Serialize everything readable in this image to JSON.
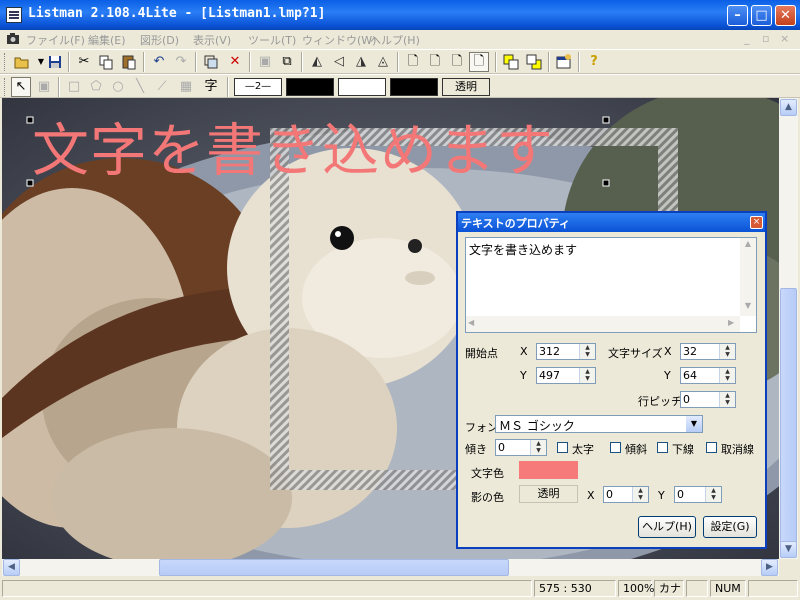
{
  "window": {
    "title": "Listman 2.108.4Lite - [Listman1.lmp?1]",
    "min_glyph": "–",
    "max_glyph": "□",
    "close_glyph": "✕"
  },
  "menu": {
    "items": [
      "ファイル(F)",
      "編集(E)",
      "図形(D)",
      "表示(V)",
      "ツール(T)",
      "ウィンドウ(W)",
      "ヘルプ(H)"
    ],
    "mdi_min": "_",
    "mdi_restore": "▫",
    "mdi_close": "×"
  },
  "toolbar2": {
    "text_tool_glyph": "字",
    "line_style": "—2—",
    "transparent_label": "透明"
  },
  "canvas": {
    "overlay_text": "文字を書き込めます",
    "overlay_color": "#f47777"
  },
  "dialog": {
    "title": "テキストのプロパティ",
    "close_glyph": "×",
    "text_value": "文字を書き込めます",
    "start_label": "開始点",
    "x_label": "X",
    "y_label": "Y",
    "start_x": "312",
    "start_y": "497",
    "size_label": "文字サイズ",
    "size_x": "32",
    "size_y": "64",
    "pitch_label": "行ピッチ",
    "pitch": "0",
    "font_label": "フォント",
    "font_value": "ＭＳ ゴシック",
    "tilt_label": "傾き",
    "tilt": "0",
    "bold_label": "太字",
    "italic_label": "傾斜",
    "underline_label": "下線",
    "strike_label": "取消線",
    "color_label": "文字色",
    "text_color": "#f77a7a",
    "shadow_label": "影の色",
    "shadow_value": "透明",
    "shadow_x": "0",
    "shadow_y": "0",
    "help_button": "ヘルプ(H)",
    "ok_button": "設定(G)"
  },
  "status": {
    "coords": "575 : 530",
    "zoom": "100%",
    "kana": "カナ",
    "num": "NUM"
  }
}
